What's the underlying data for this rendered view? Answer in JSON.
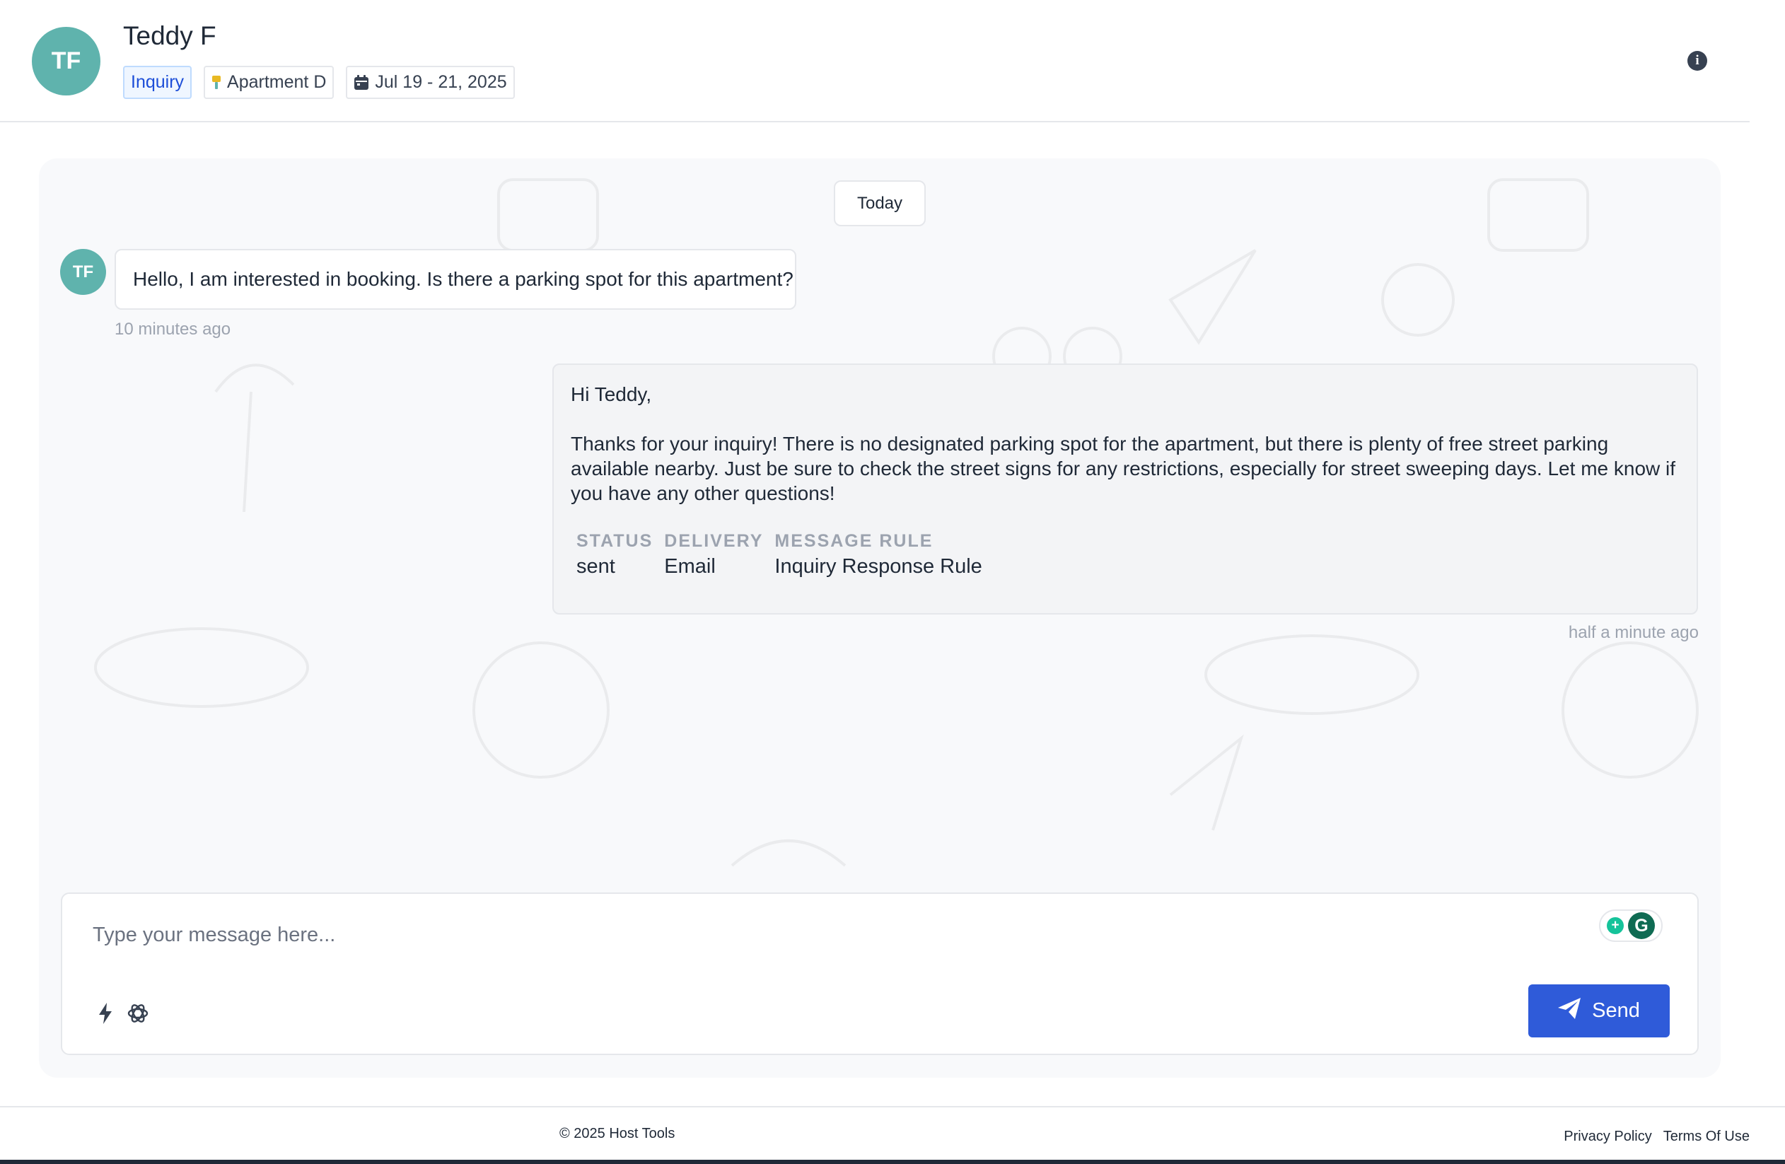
{
  "header": {
    "avatar_initials": "TF",
    "guest_name": "Teddy F",
    "tags": {
      "status": "Inquiry",
      "listing": "Apartment D",
      "dates": "Jul 19 - 21, 2025"
    },
    "info_icon": "info-icon"
  },
  "chat": {
    "date_divider": "Today",
    "incoming": {
      "avatar_initials": "TF",
      "text": "Hello, I am interested in booking. Is there a parking spot for this apartment?",
      "time": "10 minutes ago"
    },
    "outgoing": {
      "greeting": "Hi Teddy,",
      "body": "Thanks for your inquiry! There is no designated parking spot for the apartment, but there is plenty of free street parking available nearby. Just be sure to check the street signs for any restrictions, especially for street sweeping days. Let me know if you have any other questions!",
      "meta": {
        "status_label": "STATUS",
        "status_value": "sent",
        "delivery_label": "DELIVERY",
        "delivery_value": "Email",
        "rule_label": "MESSAGE RULE",
        "rule_value": "Inquiry Response Rule"
      },
      "time": "half a minute ago"
    }
  },
  "composer": {
    "placeholder": "Type your message here...",
    "value": "",
    "send_label": "Send",
    "tools": [
      "lightning-icon",
      "openai-icon"
    ],
    "grammarly_letter": "G"
  },
  "footer": {
    "copyright": "© 2025 Host Tools",
    "privacy": "Privacy Policy",
    "terms": "Terms Of Use"
  },
  "colors": {
    "avatar": "#5fb3ad",
    "send_button": "#2f5bd9",
    "inquiry_tag": "#1d4ed8"
  }
}
